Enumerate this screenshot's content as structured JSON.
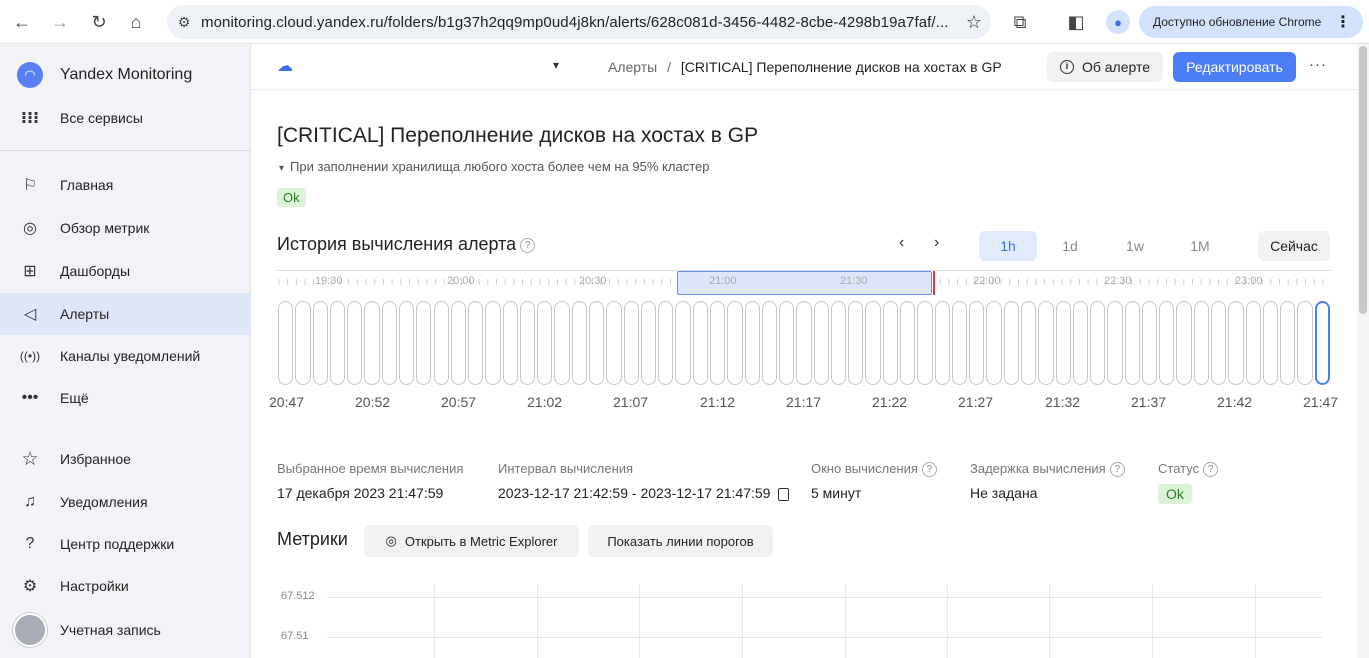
{
  "browser": {
    "url": "monitoring.cloud.yandex.ru/folders/b1g37h2qq9mp0ud4j8kn/alerts/628c081d-3456-4482-8cbe-4298b19a7faf/...",
    "update_label": "Доступно обновление Chrome"
  },
  "sidebar": {
    "product": "Yandex Monitoring",
    "all_services": "Все сервисы",
    "items": [
      {
        "label": "Главная",
        "icon": "flag-icon"
      },
      {
        "label": "Обзор метрик",
        "icon": "compass-icon"
      },
      {
        "label": "Дашборды",
        "icon": "dashboard-icon"
      },
      {
        "label": "Алерты",
        "icon": "megaphone-icon",
        "active": true
      },
      {
        "label": "Каналы уведомлений",
        "icon": "broadcast-icon"
      },
      {
        "label": "Ещё",
        "icon": "more-icon"
      }
    ],
    "bottom": [
      {
        "label": "Избранное",
        "icon": "star-icon"
      },
      {
        "label": "Уведомления",
        "icon": "bell-icon"
      },
      {
        "label": "Центр поддержки",
        "icon": "help-icon"
      },
      {
        "label": "Настройки",
        "icon": "gear-icon"
      },
      {
        "label": "Учетная запись",
        "icon": "avatar-icon"
      }
    ]
  },
  "header": {
    "breadcrumb_root": "Алерты",
    "breadcrumb_sep": "/",
    "breadcrumb_current": "[CRITICAL] Переполнение дисков на хостах в GP",
    "about_button": "Об алерте",
    "edit_button": "Редактировать"
  },
  "alert": {
    "title": "[CRITICAL] Переполнение дисков на хостах в GP",
    "description": "При заполнении хранилища любого хоста более чем на 95% кластер",
    "status": "Ok"
  },
  "history": {
    "title": "История вычисления алерта",
    "ranges": [
      "1h",
      "1d",
      "1w",
      "1M"
    ],
    "active_range": "1h",
    "now_button": "Сейчас",
    "timeline_labels": [
      "19:30",
      "20:00",
      "20:30",
      "21:00",
      "21:30",
      "22:00",
      "22:30",
      "23:00"
    ],
    "bar_count": 61,
    "time_labels": [
      "20:47",
      "20:52",
      "20:57",
      "21:02",
      "21:07",
      "21:12",
      "21:17",
      "21:22",
      "21:27",
      "21:32",
      "21:37",
      "21:42",
      "21:47"
    ]
  },
  "details": {
    "selected_time_label": "Выбранное время вычисления",
    "selected_time_value": "17 декабря 2023 21:47:59",
    "interval_label": "Интервал вычисления",
    "interval_value": "2023-12-17 21:42:59 - 2023-12-17 21:47:59",
    "window_label": "Окно вычисления",
    "window_value": "5 минут",
    "delay_label": "Задержка вычисления",
    "delay_value": "Не задана",
    "status_label": "Статус",
    "status_value": "Ok"
  },
  "metrics": {
    "title": "Метрики",
    "open_explorer": "Открыть в Metric Explorer",
    "show_thresholds": "Показать линии порогов",
    "y_ticks": [
      "67.512",
      "67.51"
    ]
  },
  "colors": {
    "accent": "#4b7df5",
    "ok_bg": "#dcf3d9",
    "ok_text": "#2f7a27",
    "now_marker": "#e53935"
  }
}
